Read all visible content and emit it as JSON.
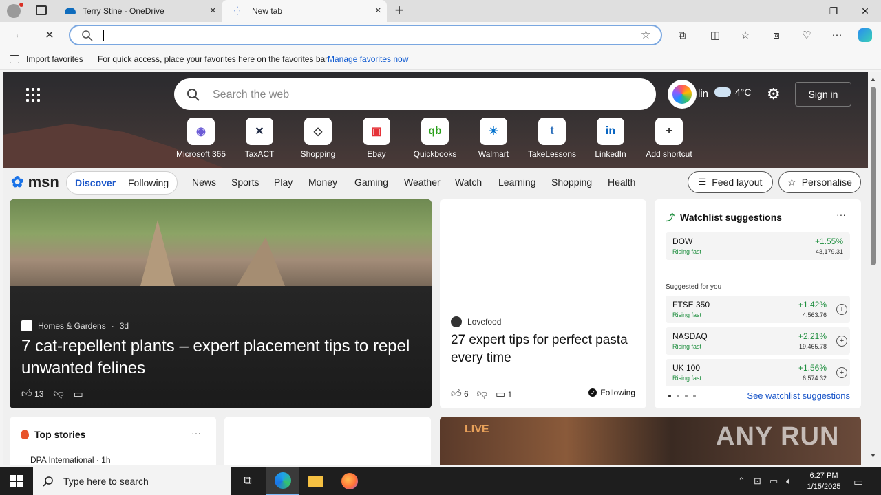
{
  "browser": {
    "tabs": [
      {
        "label": "Terry Stine - OneDrive",
        "active": false
      },
      {
        "label": "New tab",
        "active": true
      }
    ],
    "address_value": "",
    "favorites_bar": {
      "import_label": "Import favorites",
      "hint": "For quick access, place your favorites here on the favorites bar.",
      "manage_link": "Manage favorites now"
    }
  },
  "newtab": {
    "search_placeholder": "Search the web",
    "location": "lin",
    "temperature": "4°C",
    "signin_label": "Sign in",
    "shortcuts": [
      {
        "label": "Microsoft 365",
        "icon": "m365-icon",
        "glyph": "◉",
        "color": "#6b5bd6"
      },
      {
        "label": "TaxACT",
        "icon": "taxact-icon",
        "glyph": "✕",
        "color": "#1f2a44"
      },
      {
        "label": "Shopping",
        "icon": "shopping-tag-icon",
        "glyph": "◇",
        "color": "#333333"
      },
      {
        "label": "Ebay",
        "icon": "ebay-icon",
        "glyph": "▣",
        "color": "#e53238"
      },
      {
        "label": "Quickbooks",
        "icon": "quickbooks-icon",
        "glyph": "qb",
        "color": "#2ca01c"
      },
      {
        "label": "Walmart",
        "icon": "walmart-icon",
        "glyph": "✳",
        "color": "#0071ce"
      },
      {
        "label": "TakeLessons",
        "icon": "takelessons-icon",
        "glyph": "t",
        "color": "#2a6ebb"
      },
      {
        "label": "LinkedIn",
        "icon": "linkedin-icon",
        "glyph": "in",
        "color": "#0a66c2"
      },
      {
        "label": "Add shortcut",
        "icon": "plus-icon",
        "glyph": "+",
        "color": "#333333"
      }
    ]
  },
  "msn": {
    "logo": "msn",
    "tabs": {
      "discover": "Discover",
      "following": "Following"
    },
    "nav": [
      "News",
      "Sports",
      "Play",
      "Money",
      "Gaming",
      "Weather",
      "Watch",
      "Learning",
      "Shopping",
      "Health"
    ],
    "feed_layout": "Feed layout",
    "personalise": "Personalise"
  },
  "feature": {
    "source": "Homes & Gardens",
    "age": "3d",
    "headline": "7 cat-repellent plants – expert placement tips to repel unwanted felines",
    "likes": "13"
  },
  "pasta": {
    "source": "Lovefood",
    "headline": "27 expert tips for perfect pasta every time",
    "likes": "6",
    "comments": "1",
    "following": "Following"
  },
  "watchlist": {
    "title": "Watchlist suggestions",
    "top": {
      "name": "DOW",
      "trend": "Rising fast",
      "pct": "+1.55%",
      "value": "43,179.31"
    },
    "suggested_label": "Suggested for you",
    "suggested": [
      {
        "name": "FTSE 350",
        "trend": "Rising fast",
        "pct": "+1.42%",
        "value": "4,563.76"
      },
      {
        "name": "NASDAQ",
        "trend": "Rising fast",
        "pct": "+2.21%",
        "value": "19,465.78"
      },
      {
        "name": "UK 100",
        "trend": "Rising fast",
        "pct": "+1.56%",
        "value": "6,574.32"
      }
    ],
    "see_link": "See watchlist suggestions"
  },
  "topstories": {
    "title": "Top stories",
    "source": "DPA International · 1h"
  },
  "live_badge": "LIVE",
  "watermark": "ANY RUN",
  "taskbar": {
    "search_placeholder": "Type here to search",
    "time": "6:27 PM",
    "date": "1/15/2025"
  },
  "colors": {
    "accent": "#1a56c9",
    "positive": "#1e8e3e"
  }
}
